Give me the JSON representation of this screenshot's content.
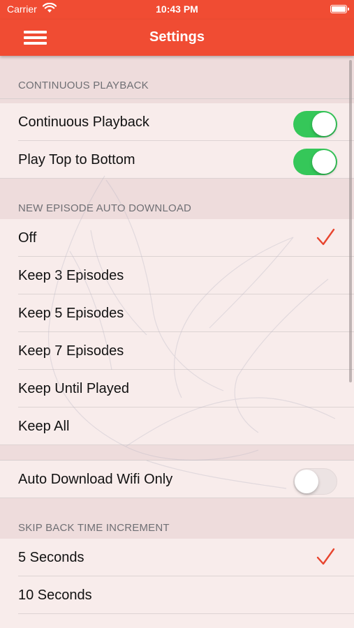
{
  "status_bar": {
    "carrier": "Carrier",
    "time": "10:43 PM"
  },
  "nav": {
    "title": "Settings",
    "menu_icon": "hamburger-menu-icon"
  },
  "accent_color": "#f04c33",
  "sections": {
    "continuous": {
      "header": "CONTINUOUS PLAYBACK",
      "rows": [
        {
          "label": "Continuous Playback",
          "toggle": true
        },
        {
          "label": "Play Top to Bottom",
          "toggle": true
        }
      ]
    },
    "auto_download": {
      "header": "NEW EPISODE AUTO DOWNLOAD",
      "options": [
        "Off",
        "Keep 3 Episodes",
        "Keep 5 Episodes",
        "Keep 7 Episodes",
        "Keep Until Played",
        "Keep All"
      ],
      "selected": "Off"
    },
    "wifi": {
      "label": "Auto Download Wifi Only",
      "toggle": false
    },
    "skip_back": {
      "header": "SKIP BACK TIME INCREMENT",
      "options": [
        "5 Seconds",
        "10 Seconds"
      ],
      "selected": "5 Seconds"
    }
  }
}
